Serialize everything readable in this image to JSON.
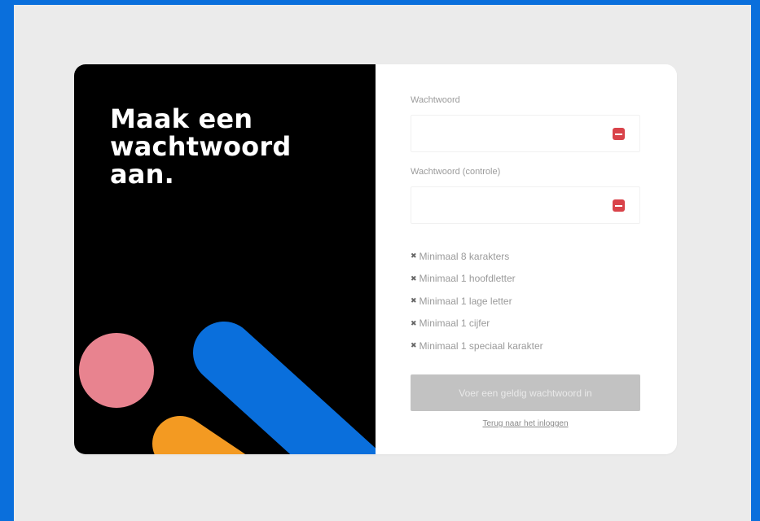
{
  "left_panel": {
    "headline": "Maak een wachtwoord aan."
  },
  "form": {
    "password_label": "Wachtwoord",
    "password_value": "",
    "confirm_label": "Wachtwoord (controle)",
    "confirm_value": "",
    "error_icon": "error-minus-icon",
    "requirements": [
      "Minimaal 8 karakters",
      "Minimaal 1 hoofdletter",
      "Minimaal 1 lage letter",
      "Minimaal 1 cijfer",
      "Minimaal 1 speciaal karakter"
    ],
    "requirement_marker": "✖",
    "submit_label": "Voer een geldig wachtwoord in",
    "back_link": "Terug naar het inloggen"
  },
  "colors": {
    "outer_border": "#0a6fdc",
    "background": "#ebebeb",
    "left_panel": "#000000",
    "shape_pink": "#e8838f",
    "shape_blue": "#0a6fdc",
    "shape_orange": "#f39a22",
    "error_red": "#d9434a",
    "disabled_button": "#c2c2c2"
  }
}
